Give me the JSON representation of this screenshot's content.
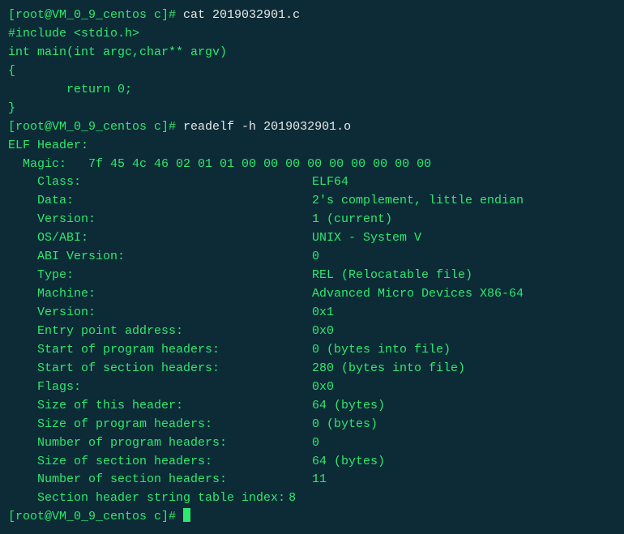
{
  "prompt1": {
    "text": "[root@VM_0_9_centos c]# ",
    "command": "cat 2019032901.c"
  },
  "source": {
    "line1": "#include <stdio.h>",
    "line2": "",
    "line3": "int main(int argc,char** argv)",
    "line4": "{",
    "line5": "        return 0;",
    "line6": "}"
  },
  "prompt2": {
    "text": "[root@VM_0_9_centos c]# ",
    "command": "readelf -h 2019032901.o"
  },
  "elf": {
    "title": "ELF Header:",
    "magic_label": "  Magic:   ",
    "magic_value": "7f 45 4c 46 02 01 01 00 00 00 00 00 00 00 00 00 ",
    "rows": [
      {
        "label": "  Class:",
        "value": "ELF64"
      },
      {
        "label": "  Data:",
        "value": "2's complement, little endian"
      },
      {
        "label": "  Version:",
        "value": "1 (current)"
      },
      {
        "label": "  OS/ABI:",
        "value": "UNIX - System V"
      },
      {
        "label": "  ABI Version:",
        "value": "0"
      },
      {
        "label": "  Type:",
        "value": "REL (Relocatable file)"
      },
      {
        "label": "  Machine:",
        "value": "Advanced Micro Devices X86-64"
      },
      {
        "label": "  Version:",
        "value": "0x1"
      },
      {
        "label": "  Entry point address:",
        "value": "0x0"
      },
      {
        "label": "  Start of program headers:",
        "value": "0 (bytes into file)"
      },
      {
        "label": "  Start of section headers:",
        "value": "280 (bytes into file)"
      },
      {
        "label": "  Flags:",
        "value": "0x0"
      },
      {
        "label": "  Size of this header:",
        "value": "64 (bytes)"
      },
      {
        "label": "  Size of program headers:",
        "value": "0 (bytes)"
      },
      {
        "label": "  Number of program headers:",
        "value": "0"
      },
      {
        "label": "  Size of section headers:",
        "value": "64 (bytes)"
      },
      {
        "label": "  Number of section headers:",
        "value": "11"
      },
      {
        "label": "  Section header string table index:",
        "value": "8",
        "tight": true
      }
    ]
  },
  "prompt3": {
    "text": "[root@VM_0_9_centos c]# "
  }
}
